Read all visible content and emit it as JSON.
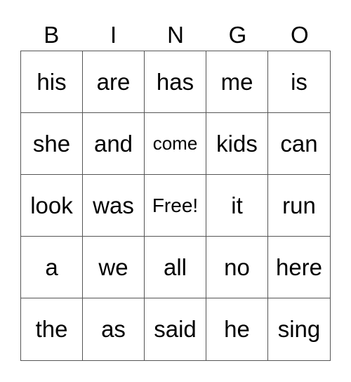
{
  "header": [
    "B",
    "I",
    "N",
    "G",
    "O"
  ],
  "cells": [
    "his",
    "are",
    "has",
    "me",
    "is",
    "she",
    "and",
    "come",
    "kids",
    "can",
    "look",
    "was",
    "Free!",
    "it",
    "run",
    "a",
    "we",
    "all",
    "no",
    "here",
    "the",
    "as",
    "said",
    "he",
    "sing"
  ]
}
